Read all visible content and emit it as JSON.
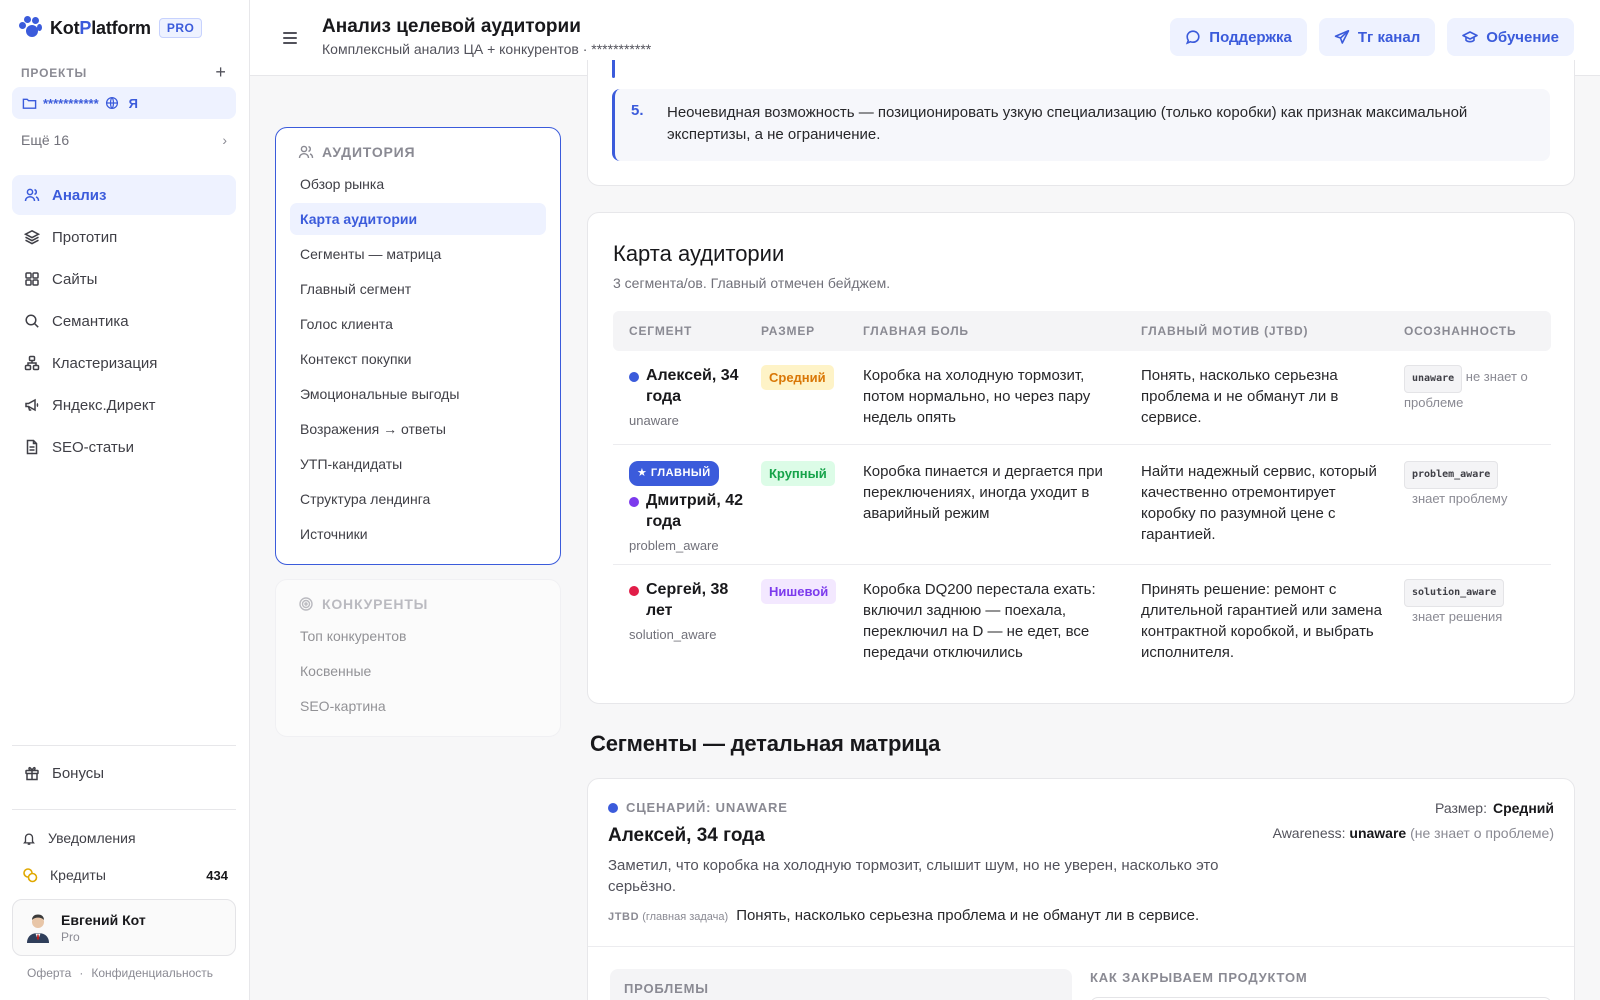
{
  "app": {
    "brand_a": "Kot",
    "brand_b": "P",
    "brand_c": "latform",
    "pro_label": "PRO",
    "accent": "#3b5bdb"
  },
  "sidebar": {
    "projects_heading": "ПРОЕКТЫ",
    "project_name": "***********",
    "project_suffix": "Я",
    "more_label": "Ещё 16",
    "nav": [
      {
        "label": "Анализ",
        "icon": "users-icon",
        "active": true
      },
      {
        "label": "Прототип",
        "icon": "layers-icon"
      },
      {
        "label": "Сайты",
        "icon": "grid-icon"
      },
      {
        "label": "Семантика",
        "icon": "search-icon"
      },
      {
        "label": "Кластеризация",
        "icon": "cluster-icon"
      },
      {
        "label": "Яндекс.Директ",
        "icon": "megaphone-icon"
      },
      {
        "label": "SEO-статьи",
        "icon": "document-icon"
      }
    ],
    "bonus_label": "Бонусы",
    "notifications_label": "Уведомления",
    "credits_label": "Кредиты",
    "credits_value": "434",
    "user_name": "Евгений Кот",
    "user_plan": "Pro",
    "legal_offer": "Оферта",
    "legal_dot": "·",
    "legal_privacy": "Конфиденциальность"
  },
  "header": {
    "title": "Анализ целевой аудитории",
    "subtitle": "Комплексный анализ ЦА + конкурентов · ***********",
    "buttons": [
      {
        "label": "Поддержка",
        "icon": "chat-icon"
      },
      {
        "label": "Тг канал",
        "icon": "telegram-icon"
      },
      {
        "label": "Обучение",
        "icon": "graduation-icon"
      }
    ]
  },
  "toc": {
    "audience_title": "АУДИТОРИЯ",
    "audience_items": [
      "Обзор рынка",
      "Карта аудитории",
      "Сегменты — матрица",
      "Главный сегмент",
      "Голос клиента",
      "Контекст покупки",
      "Эмоциональные выгоды",
      "Возражения → ответы",
      "УТП-кандидаты",
      "Структура лендинга",
      "Источники"
    ],
    "active_index": 1,
    "competitors_title": "КОНКУРЕНТЫ",
    "competitor_items": [
      "Топ конкурентов",
      "Косвенные",
      "SEO-картина"
    ]
  },
  "insight": {
    "number": "5.",
    "text": "Неочевидная возможность — позиционировать узкую специализацию (только коробки) как признак максимальной экспертизы, а не ограничение."
  },
  "audience_map": {
    "title": "Карта аудитории",
    "subtitle": "3 сегмента/ов. Главный отмечен бейджем.",
    "columns": [
      "СЕГМЕНТ",
      "РАЗМЕР",
      "ГЛАВНАЯ БОЛЬ",
      "ГЛАВНЫЙ МОТИВ (JTBD)",
      "ОСОЗНАННОСТЬ"
    ],
    "main_badge": "★ ГЛАВНЫЙ",
    "rows": [
      {
        "name": "Алексей, 34 года",
        "awareness_key": "unaware",
        "dot_color": "#3b5bdb",
        "size": "Средний",
        "size_color": "#d97706",
        "size_bg": "#fef3c7",
        "pain": "Коробка на холодную тормозит, потом нормально, но через пару недель опять",
        "motive": "Понять, насколько серьезна проблема и не обманут ли в сервисе.",
        "awareness_code": "unaware",
        "awareness_text": "не знает о проблеме",
        "main": false
      },
      {
        "name": "Дмитрий, 42 года",
        "awareness_key": "problem_aware",
        "dot_color": "#7c3aed",
        "size": "Крупный",
        "size_color": "#16a34a",
        "size_bg": "#dcfce7",
        "pain": "Коробка пинается и дергается при переключениях, иногда уходит в аварийный режим",
        "motive": "Найти надежный сервис, который качественно отремонтирует коробку по разумной цене с гарантией.",
        "awareness_code": "problem_aware",
        "awareness_text": "знает проблему",
        "main": true
      },
      {
        "name": "Сергей, 38 лет",
        "awareness_key": "solution_aware",
        "dot_color": "#e11d48",
        "size": "Нишевой",
        "size_color": "#7c3aed",
        "size_bg": "#f3e8ff",
        "pain": "Коробка DQ200 перестала ехать: включил заднюю — поехала, переключил на D — не едет, все передачи отключились",
        "motive": "Принять решение: ремонт с длительной гарантией или замена контрактной коробкой, и выбрать исполнителя.",
        "awareness_code": "solution_aware",
        "awareness_text": "знает решения",
        "main": false
      }
    ]
  },
  "matrix": {
    "heading": "Сегменты — детальная матрица",
    "scenario_label": "СЦЕНАРИЙ: UNAWARE",
    "name": "Алексей, 34 года",
    "description": "Заметил, что коробка на холодную тормозит, слышит шум, но не уверен, насколько это серьёзно.",
    "jtbd_key": "JTBD",
    "jtbd_hint": "(главная задача)",
    "jtbd_text": "Понять, насколько серьезна проблема и не обманут ли в сервисе.",
    "size_label": "Размер:",
    "size_value": "Средний",
    "awareness_label": "Awareness:",
    "awareness_value": "unaware",
    "awareness_hint": "(не знает о проблеме)",
    "problems_label": "ПРОБЛЕМЫ",
    "solve_label": "КАК ЗАКРЫВАЕМ ПРОДУКТОМ"
  }
}
